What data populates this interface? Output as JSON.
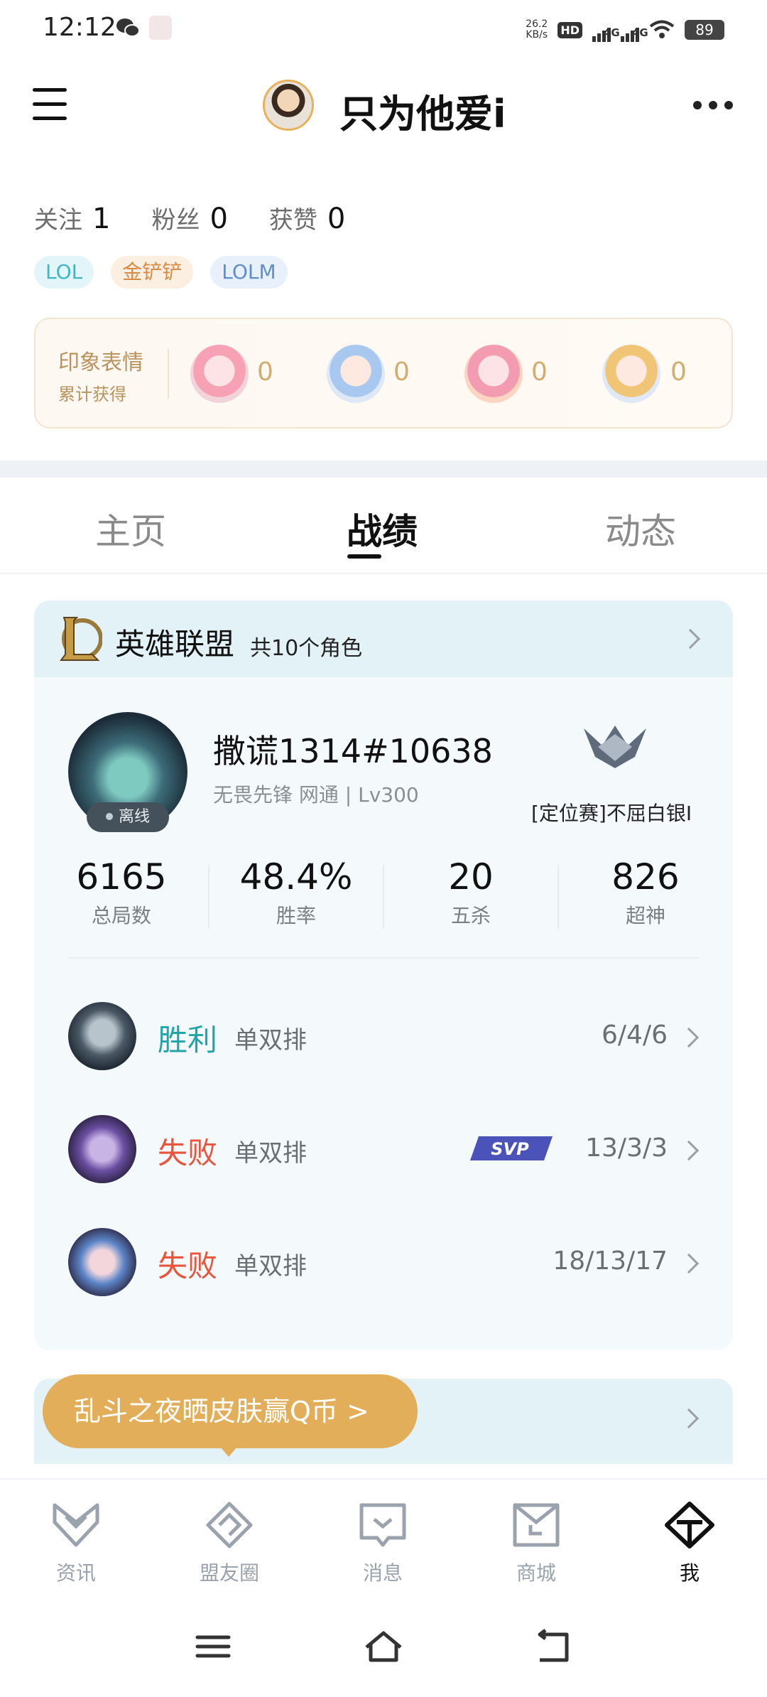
{
  "status_bar": {
    "time": "12:12",
    "speed_value": "26.2",
    "speed_unit": "KB/s",
    "hd": "HD",
    "sim1": "4G",
    "sim2": "4G",
    "battery": "89"
  },
  "header": {
    "username": "只为他爱i"
  },
  "profile_stats": [
    {
      "label": "关注",
      "value": "1"
    },
    {
      "label": "粉丝",
      "value": "0"
    },
    {
      "label": "获赞",
      "value": "0"
    }
  ],
  "tags": [
    "LOL",
    "金铲铲",
    "LOLM"
  ],
  "impression": {
    "title": "印象表情",
    "subtitle": "累计获得",
    "counts": [
      "0",
      "0",
      "0",
      "0"
    ]
  },
  "tabs": [
    "主页",
    "战绩",
    "动态"
  ],
  "active_tab": "战绩",
  "game_card": {
    "name": "英雄联盟",
    "count": "共10个角色",
    "player_name": "撒谎1314#10638",
    "player_info": "无畏先锋 网通 | Lv300",
    "status": "离线",
    "rank": "[定位赛]不屈白银I",
    "metrics": [
      {
        "value": "6165",
        "label": "总局数"
      },
      {
        "value": "48.4%",
        "label": "胜率"
      },
      {
        "value": "20",
        "label": "五杀"
      },
      {
        "value": "826",
        "label": "超神"
      }
    ],
    "matches": [
      {
        "result": "胜利",
        "mode": "单双排",
        "kda": "6/4/6",
        "svp": false
      },
      {
        "result": "失败",
        "mode": "单双排",
        "kda": "13/3/3",
        "svp": true
      },
      {
        "result": "失败",
        "mode": "单双排",
        "kda": "18/13/17",
        "svp": false
      }
    ]
  },
  "banner": {
    "text": "乱斗之夜晒皮肤赢Q币 >"
  },
  "bottom_nav": [
    {
      "label": "资讯",
      "icon": "news-icon"
    },
    {
      "label": "盟友圈",
      "icon": "friends-circle-icon"
    },
    {
      "label": "消息",
      "icon": "message-icon"
    },
    {
      "label": "商城",
      "icon": "shop-icon"
    },
    {
      "label": "我",
      "icon": "me-icon"
    }
  ],
  "colors": {
    "win": "#22a5a8",
    "lose": "#e8553c",
    "accent_gold": "#e3ae59"
  }
}
